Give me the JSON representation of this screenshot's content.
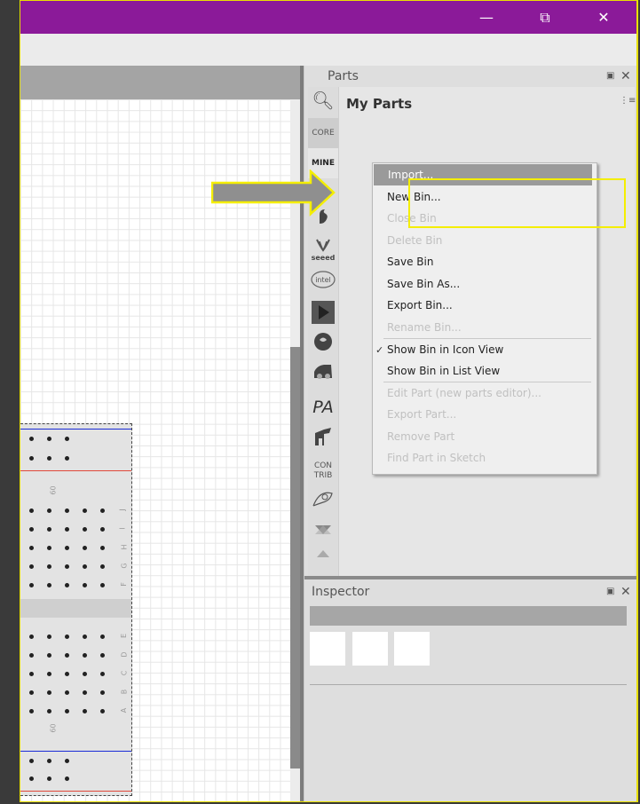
{
  "window": {
    "controls": {
      "minimize": "—",
      "restore": "⧉",
      "close": "✕"
    },
    "title_color": "#8b1a99"
  },
  "parts": {
    "title": "Parts",
    "float_icon": "float-icon",
    "close": "✕",
    "bin_title": "My Parts",
    "bin_menu_icon": "⋮≡",
    "bin_tabs": [
      {
        "label": "",
        "icon": "search-icon"
      },
      {
        "label": "CORE",
        "icon": "core-bin"
      },
      {
        "label": "MINE",
        "icon": "mine-bin"
      },
      {
        "label": "",
        "icon": "arduino-icon"
      },
      {
        "label": "",
        "icon": "sparkfun-icon"
      },
      {
        "label": "seeed",
        "icon": "seeed-icon"
      },
      {
        "label": "intel",
        "icon": "intel-icon"
      },
      {
        "label": "",
        "icon": "play-icon"
      },
      {
        "label": "",
        "icon": "snootlab-icon"
      },
      {
        "label": "",
        "icon": "car-icon"
      },
      {
        "label": "PA",
        "icon": "pa-icon"
      },
      {
        "label": "",
        "icon": "animal-icon"
      },
      {
        "label": "CON\nTRIB",
        "icon": "contrib-icon"
      },
      {
        "label": "",
        "icon": "fabu-icon"
      },
      {
        "label": "",
        "icon": "more-icon"
      }
    ]
  },
  "context_menu": {
    "items": [
      {
        "label": "Import...",
        "state": "highlighted"
      },
      {
        "label": "New Bin...",
        "state": "enabled"
      },
      {
        "label": "Close Bin",
        "state": "disabled"
      },
      {
        "label": "Delete Bin",
        "state": "disabled"
      },
      {
        "label": "Save Bin",
        "state": "enabled"
      },
      {
        "label": "Save Bin As...",
        "state": "enabled"
      },
      {
        "label": "Export Bin...",
        "state": "enabled"
      },
      {
        "label": "Rename Bin...",
        "state": "disabled"
      },
      {
        "label": "Show Bin in Icon View",
        "state": "checked"
      },
      {
        "label": "Show Bin in List View",
        "state": "enabled"
      },
      {
        "label": "Edit Part (new parts editor)...",
        "state": "disabled"
      },
      {
        "label": "Export Part...",
        "state": "disabled"
      },
      {
        "label": "Remove Part",
        "state": "disabled"
      },
      {
        "label": "Find Part in Sketch",
        "state": "disabled"
      }
    ],
    "check_mark": "✓"
  },
  "inspector": {
    "title": "Inspector",
    "close": "✕"
  },
  "breadboard": {
    "row_labels_top": [
      "J",
      "I",
      "H",
      "G",
      "F"
    ],
    "row_labels_bottom": [
      "E",
      "D",
      "C",
      "B",
      "A"
    ],
    "column_number": "60"
  },
  "colors": {
    "annotation_yellow": "#f4ee00",
    "rail_blue": "#1a2bd6",
    "rail_red": "#e0483a"
  }
}
